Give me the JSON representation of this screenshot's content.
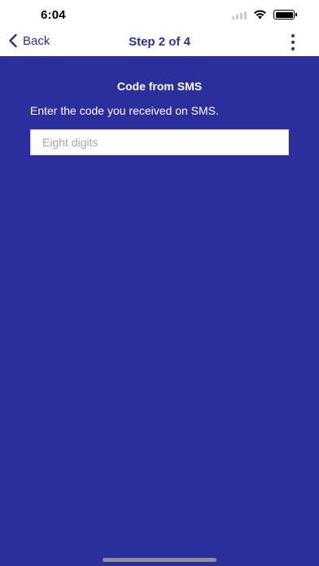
{
  "status_bar": {
    "time": "6:04"
  },
  "nav": {
    "back_label": "Back",
    "title": "Step 2 of 4",
    "back_icon": "chevron-left-icon",
    "more_icon": "more-vertical-icon"
  },
  "form": {
    "heading": "Code from SMS",
    "description": "Enter the code you received on SMS.",
    "code_placeholder": "Eight digits",
    "code_value": ""
  },
  "colors": {
    "brand": "#2b2f9e",
    "background": "#2b2f9e",
    "bar": "#ffffff"
  }
}
